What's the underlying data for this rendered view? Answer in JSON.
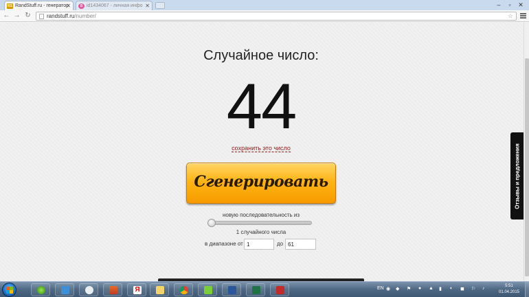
{
  "browser": {
    "tabs": [
      {
        "title": "RandStuff.ru - генератор",
        "favicon": "RS",
        "active": true
      },
      {
        "title": "id1434067 - личная инфо",
        "favicon": "B",
        "active": false
      }
    ],
    "address": {
      "domain": "randstuff.ru",
      "path": "/number/"
    }
  },
  "page": {
    "title": "Случайное число:",
    "number": "44",
    "save_link": "сохранить это число",
    "generate_button": "Сгенерировать",
    "sequence_label": "новую последовательность из",
    "sequence_count_fraction": 0.0,
    "count_label": "1 случайного числа",
    "range_from_label": "в диапазоне от",
    "range_to_label": "до",
    "range_from": "1",
    "range_to": "61",
    "feedback_tab": "Отзывы и предложения"
  },
  "taskbar": {
    "language": "EN",
    "clock_time": "5:51",
    "clock_date": "01.04.2015",
    "apps": [
      "icq-icon",
      "mail-icon",
      "hp-icon",
      "stack-icon",
      "yandex-icon",
      "explorer-folder-icon",
      "chrome-icon",
      "download-icon",
      "word-icon",
      "excel-icon",
      "pdf-icon"
    ]
  },
  "colors": {
    "button_top": "#ffd566",
    "button_bottom": "#f69a00",
    "save_link": "#8a1c1c",
    "feedback_bg": "#111111"
  }
}
